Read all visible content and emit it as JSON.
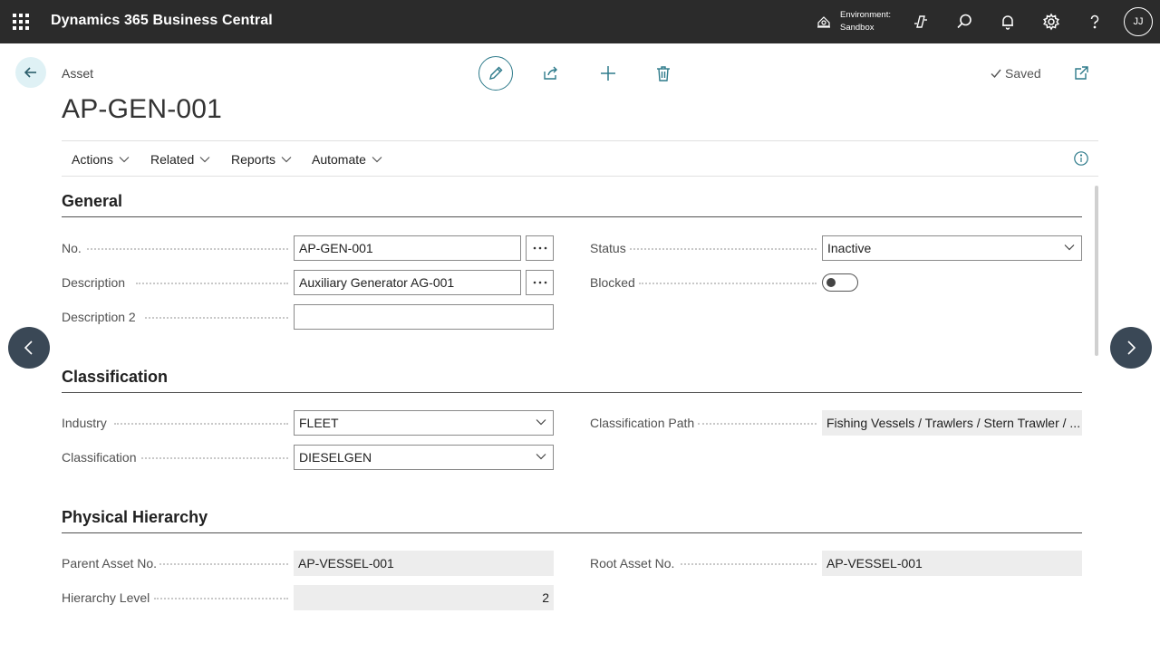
{
  "app": {
    "title": "Dynamics 365 Business Central",
    "user_initials": "JJ"
  },
  "topbar": {
    "env_label": "Environment:",
    "env_value": "Sandbox",
    "icons": [
      "waffle-icon",
      "environment-icon",
      "copilot-icon",
      "search-icon",
      "bell-icon",
      "gear-icon",
      "help-icon"
    ]
  },
  "header": {
    "breadcrumb": "Asset",
    "title": "AP-GEN-001",
    "saved_label": "Saved",
    "toolbar_icons": [
      "edit-icon",
      "share-icon",
      "new-icon",
      "delete-icon",
      "open-new-window-icon"
    ]
  },
  "actionbar": {
    "items": [
      "Actions",
      "Related",
      "Reports",
      "Automate"
    ]
  },
  "sections": {
    "general": {
      "title": "General",
      "no_label": "No.",
      "no_value": "AP-GEN-001",
      "description_label": "Description",
      "description_value": "Auxiliary Generator AG-001",
      "description2_label": "Description 2",
      "description2_value": "",
      "status_label": "Status",
      "status_value": "Inactive",
      "blocked_label": "Blocked",
      "blocked_value": false
    },
    "classification": {
      "title": "Classification",
      "industry_label": "Industry",
      "industry_value": "FLEET",
      "classification_label": "Classification",
      "classification_value": "DIESELGEN",
      "path_label": "Classification Path",
      "path_value": "Fishing Vessels / Trawlers / Stern Trawler / ..."
    },
    "physical_hierarchy": {
      "title": "Physical Hierarchy",
      "parent_label": "Parent Asset No.",
      "parent_value": "AP-VESSEL-001",
      "level_label": "Hierarchy Level",
      "level_value": "2",
      "root_label": "Root Asset No.",
      "root_value": "AP-VESSEL-001"
    }
  },
  "colors": {
    "topbar": "#2b2b2b",
    "accent": "#2d7a8a",
    "nav_arrow": "#3a4856",
    "readonly_bg": "#ededed"
  }
}
